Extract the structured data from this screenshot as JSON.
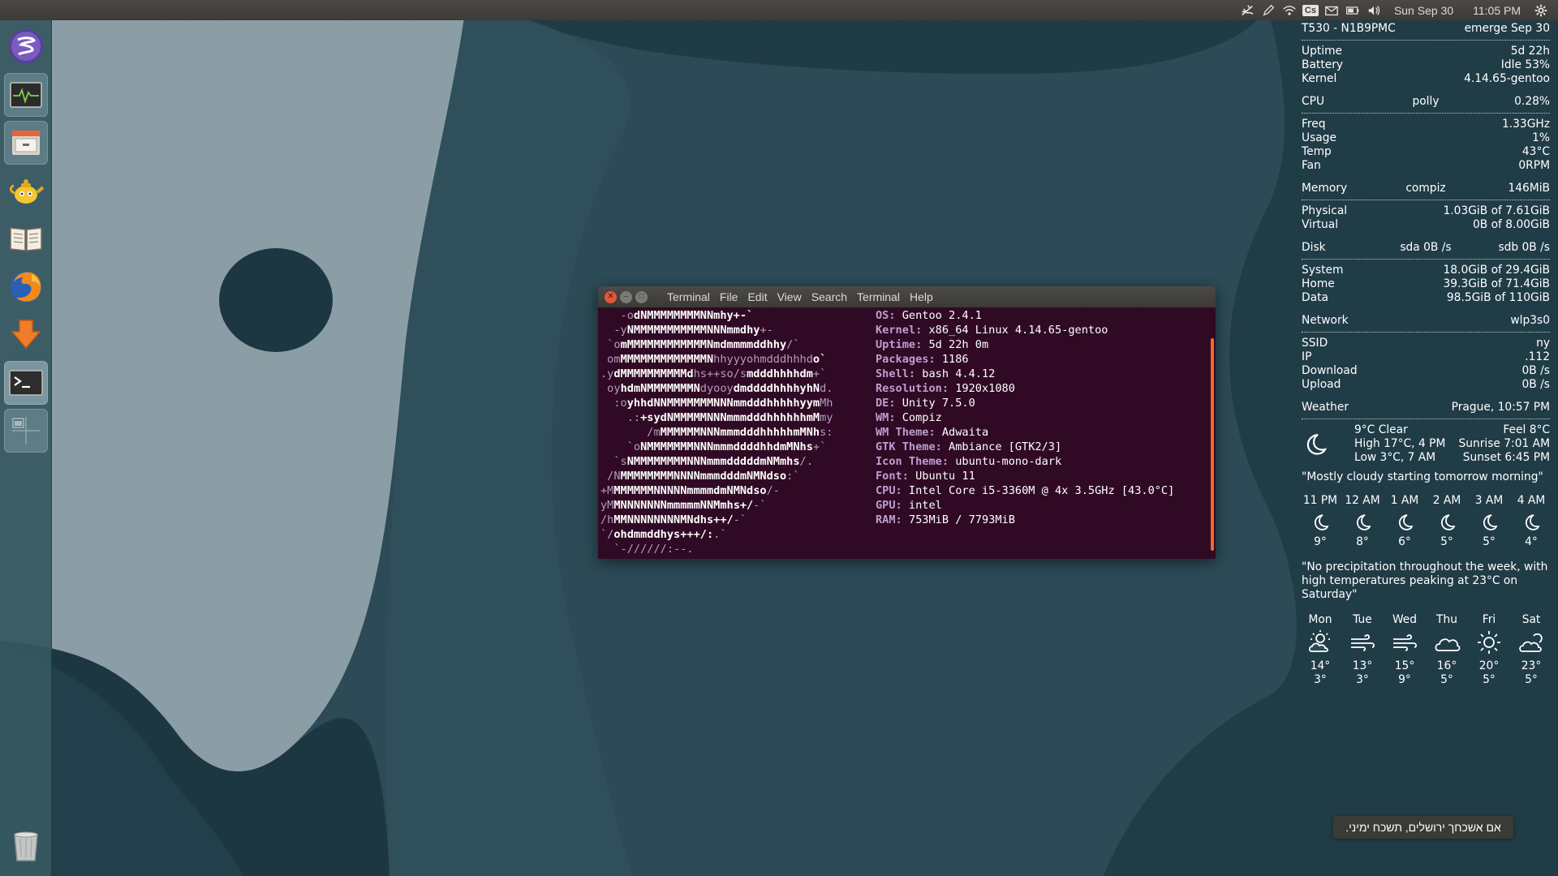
{
  "top_panel": {
    "date": "Sun Sep 30",
    "time": "11:05 PM",
    "tray_icons": [
      "weather-icon",
      "pencil-icon",
      "wifi-icon",
      "cs-icon",
      "mail-icon",
      "battery-icon",
      "volume-icon",
      "settings-gear-icon"
    ],
    "cs_label": "Cs"
  },
  "launcher": {
    "items": [
      "emacs-icon",
      "system-monitor-icon",
      "file-manager-icon",
      "teapot-icon",
      "book-reader-icon",
      "firefox-icon",
      "downloader-icon",
      "terminal-icon",
      "workspace-switcher-icon",
      "trash-icon"
    ]
  },
  "terminal": {
    "menu": [
      "Terminal",
      "File",
      "Edit",
      "View",
      "Search",
      "Terminal",
      "Help"
    ],
    "logo": [
      [
        "   -o",
        "dNMMMMMMMMNNmhy+-`",
        ""
      ],
      [
        "  -y",
        "NMMMMMMMMMMMNNNmmdhy",
        "+-"
      ],
      [
        " `o",
        "mMMMMMMMMMMMMNmdmmmmddhhy",
        "/`"
      ],
      [
        " om",
        "MMMMMMMMMMMMMN",
        "hhyyyohmdddhhhd",
        "o`"
      ],
      [
        ".y",
        "dMMMMMMMMMMd",
        "hs++so/s",
        "mdddhhhhdm",
        "+`"
      ],
      [
        " oy",
        "hdmNMMMMMMMN",
        "dyooy",
        "dmddddhhhhyhN",
        "d."
      ],
      [
        "  :o",
        "yhhdNNMMMMMMMNNNmmdddhhhhhyym",
        "Mh"
      ],
      [
        "    .:",
        "+sydNMMMMMNNNmmmdddhhhhhhmM",
        "my"
      ],
      [
        "       /m",
        "MMMMMMNNNmmmdddhhhhhmMNh",
        "s:"
      ],
      [
        "    `o",
        "NMMMMMMMNNNmmmddddhhdmMNhs",
        "+`"
      ],
      [
        "  `s",
        "NMMMMMMMMNNNmmmdddddmNMmhs",
        "/."
      ],
      [
        " /N",
        "MMMMMMMMNNNNmmmdddmNMNdso",
        ":`"
      ],
      [
        "+M",
        "MMMMMMNNNNNmmmmdmNMNdso",
        "/-"
      ],
      [
        "yM",
        "MNNNNNNNmmmmmNNMmhs+/",
        "-`"
      ],
      [
        "/h",
        "MMNNNNNNNNMNdhs++/",
        "-`"
      ],
      [
        "`/",
        "ohdmmddhys+++/:",
        ".`"
      ],
      [
        "  `-//////:--.",
        "",
        ""
      ]
    ],
    "info": [
      {
        "key": "OS:",
        "val": " Gentoo 2.4.1"
      },
      {
        "key": "Kernel:",
        "val": " x86_64 Linux 4.14.65-gentoo"
      },
      {
        "key": "Uptime:",
        "val": " 5d 22h 0m"
      },
      {
        "key": "Packages:",
        "val": " 1186"
      },
      {
        "key": "Shell:",
        "val": " bash 4.4.12"
      },
      {
        "key": "Resolution:",
        "val": " 1920x1080"
      },
      {
        "key": "DE:",
        "val": " Unity 7.5.0"
      },
      {
        "key": "WM:",
        "val": " Compiz"
      },
      {
        "key": "WM Theme:",
        "val": " Adwaita"
      },
      {
        "key": "GTK Theme:",
        "val": " Ambiance [GTK2/3]"
      },
      {
        "key": "Icon Theme:",
        "val": " ubuntu-mono-dark"
      },
      {
        "key": "Font:",
        "val": " Ubuntu 11"
      },
      {
        "key": "CPU:",
        "val": " Intel Core i5-3360M @ 4x 3.5GHz [43.0°C]"
      },
      {
        "key": "GPU:",
        "val": " intel"
      },
      {
        "key": "RAM:",
        "val": " 753MiB / 7793MiB"
      }
    ]
  },
  "conky": {
    "host": "T530 - N1B9PMC",
    "emerge": "emerge Sep 30",
    "system": [
      {
        "label": "Uptime",
        "value": "5d 22h"
      },
      {
        "label": "Battery",
        "value": "Idle 53%"
      },
      {
        "label": "Kernel",
        "value": "4.14.65-gentoo"
      }
    ],
    "cpu_head": {
      "l": "CPU",
      "m": "polly",
      "r": "0.28%"
    },
    "cpu": [
      {
        "label": "Freq",
        "value": "1.33GHz"
      },
      {
        "label": "Usage",
        "value": "1%"
      },
      {
        "label": "Temp",
        "value": "43°C"
      },
      {
        "label": "Fan",
        "value": "0RPM"
      }
    ],
    "mem_head": {
      "l": "Memory",
      "m": "compiz",
      "r": "146MiB"
    },
    "mem": [
      {
        "label": "Physical",
        "value": "1.03GiB of 7.61GiB"
      },
      {
        "label": "Virtual",
        "value": "0B  of 8.00GiB"
      }
    ],
    "disk_head": {
      "l": "Disk",
      "m": "sda 0B /s",
      "r": "sdb 0B /s"
    },
    "disk": [
      {
        "label": "System",
        "value": "18.0GiB of 29.4GiB"
      },
      {
        "label": "Home",
        "value": "39.3GiB of 71.4GiB"
      },
      {
        "label": "Data",
        "value": "98.5GiB of 110GiB"
      }
    ],
    "net_head": {
      "l": "Network",
      "r": "wlp3s0"
    },
    "net": [
      {
        "label": "SSID",
        "value": "ny"
      },
      {
        "label": "IP",
        "value": ".112"
      },
      {
        "label": "Download",
        "value": "0B /s"
      },
      {
        "label": "Upload",
        "value": "0B /s"
      }
    ],
    "weather_head": {
      "l": "Weather",
      "r": "Prague, 10:57 PM"
    },
    "weather_now": {
      "condition": "9°C Clear",
      "high": "High 17°C, 4 PM",
      "low": "Low 3°C, 7 AM",
      "feel": "Feel 8°C",
      "sunrise": "Sunrise 7:01 AM",
      "sunset": "Sunset 6:45 PM"
    },
    "quote1": "\"Mostly cloudy starting tomorrow morning\"",
    "hourly": [
      {
        "time": "11 PM",
        "temp": "9°"
      },
      {
        "time": "12 AM",
        "temp": "8°"
      },
      {
        "time": "1 AM",
        "temp": "6°"
      },
      {
        "time": "2 AM",
        "temp": "5°"
      },
      {
        "time": "3 AM",
        "temp": "5°"
      },
      {
        "time": "4 AM",
        "temp": "4°"
      }
    ],
    "quote2": "\"No precipitation throughout the week, with high temperatures peaking at 23°C on Saturday\"",
    "daily": [
      {
        "day": "Mon",
        "high": "14°",
        "low": "3°",
        "icon": "partly-cloudy-day-icon"
      },
      {
        "day": "Tue",
        "high": "13°",
        "low": "3°",
        "icon": "wind-icon"
      },
      {
        "day": "Wed",
        "high": "15°",
        "low": "9°",
        "icon": "wind-icon"
      },
      {
        "day": "Thu",
        "high": "16°",
        "low": "5°",
        "icon": "cloudy-icon"
      },
      {
        "day": "Fri",
        "high": "20°",
        "low": "5°",
        "icon": "clear-day-icon"
      },
      {
        "day": "Sat",
        "high": "23°",
        "low": "5°",
        "icon": "partly-cloudy-icon"
      }
    ]
  },
  "note": "אם אשכחך ירושלים, תשכח ימיני."
}
